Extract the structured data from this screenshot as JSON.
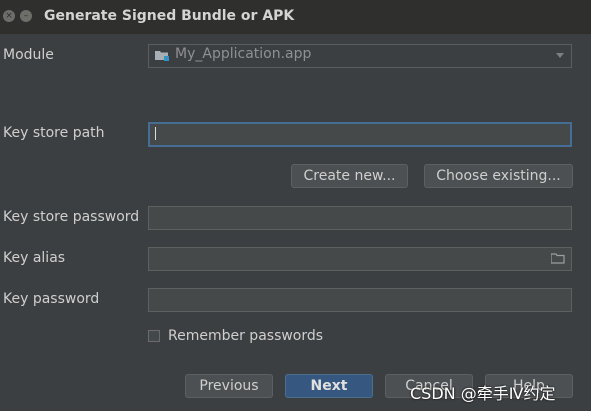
{
  "window": {
    "title": "Generate Signed Bundle or APK",
    "close_glyph": "×",
    "minimize_glyph": "–"
  },
  "module": {
    "label": "Module",
    "value": "My_Application.app",
    "icon": "folder-module-icon"
  },
  "keystore": {
    "path_label": "Key store path",
    "path_value": "",
    "create_new_label": "Create new...",
    "choose_existing_label": "Choose existing...",
    "password_label": "Key store password",
    "password_value": ""
  },
  "key": {
    "alias_label": "Key alias",
    "alias_value": "",
    "password_label": "Key password",
    "password_value": ""
  },
  "remember": {
    "label": "Remember passwords",
    "checked": false
  },
  "footer": {
    "previous_label": "Previous",
    "next_label": "Next",
    "cancel_label": "Cancel",
    "help_label": "Help"
  },
  "watermark": "CSDN @牵手Ⅳ约定",
  "colors": {
    "background": "#3c3f41",
    "titlebar": "#2f2f2d",
    "primary_button": "#365880",
    "focus_border": "#466d94"
  }
}
